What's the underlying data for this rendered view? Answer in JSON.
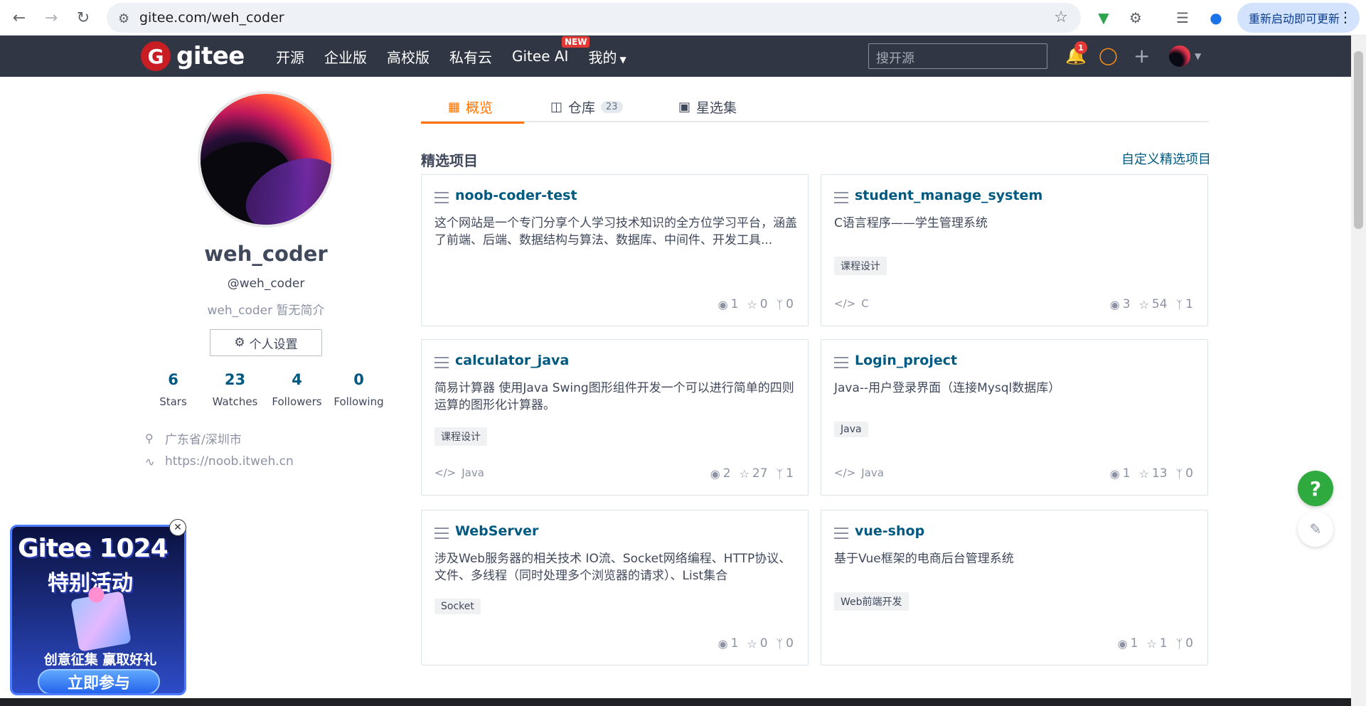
{
  "browser": {
    "url": "gitee.com/weh_coder",
    "update_label": "重新启动即可更新"
  },
  "header": {
    "logo_text": "gitee",
    "nav": [
      {
        "label": "开源"
      },
      {
        "label": "企业版"
      },
      {
        "label": "高校版"
      },
      {
        "label": "私有云"
      },
      {
        "label": "Gitee AI",
        "badge": "NEW"
      },
      {
        "label": "我的"
      }
    ],
    "search_placeholder": "搜开源",
    "notification_count": "1"
  },
  "profile": {
    "username": "weh_coder",
    "handle": "@weh_coder",
    "bio": "weh_coder 暂无简介",
    "settings_label": "个人设置",
    "stats": [
      {
        "num": "6",
        "label": "Stars"
      },
      {
        "num": "23",
        "label": "Watches"
      },
      {
        "num": "4",
        "label": "Followers"
      },
      {
        "num": "0",
        "label": "Following"
      }
    ],
    "location": "广东省/深圳市",
    "website": "https://noob.itweh.cn"
  },
  "tabs": [
    {
      "label": "概览",
      "icon": "code-icon",
      "active": true
    },
    {
      "label": "仓库",
      "icon": "repo-icon",
      "count": "23"
    },
    {
      "label": "星选集",
      "icon": "collection-icon"
    }
  ],
  "featured": {
    "title": "精选项目",
    "customize_label": "自定义精选项目",
    "projects": [
      {
        "name": "noob-coder-test",
        "desc": "这个网站是一个专门分享个人学习技术知识的全方位学习平台，涵盖了前端、后端、数据结构与算法、数据库、中间件、开发工具...",
        "tag": "",
        "lang": "",
        "watch": "1",
        "star": "0",
        "fork": "0"
      },
      {
        "name": "student_manage_system",
        "desc": "C语言程序——学生管理系统",
        "tag": "课程设计",
        "lang": "C",
        "watch": "3",
        "star": "54",
        "fork": "1"
      },
      {
        "name": "calculator_java",
        "desc": "简易计算器 使用Java Swing图形组件开发一个可以进行简单的四则运算的图形化计算器。",
        "tag": "课程设计",
        "lang": "Java",
        "watch": "2",
        "star": "27",
        "fork": "1"
      },
      {
        "name": "Login_project",
        "desc": "Java--用户登录界面（连接Mysql数据库）",
        "tag": "Java",
        "lang": "Java",
        "watch": "1",
        "star": "13",
        "fork": "0"
      },
      {
        "name": "WebServer",
        "desc": "涉及Web服务器的相关技术 IO流、Socket网络编程、HTTP协议、文件、多线程（同时处理多个浏览器的请求）、List集合",
        "tag": "Socket",
        "lang": "",
        "watch": "1",
        "star": "0",
        "fork": "0"
      },
      {
        "name": "vue-shop",
        "desc": "基于Vue框架的电商后台管理系统",
        "tag": "Web前端开发",
        "lang": "",
        "watch": "1",
        "star": "1",
        "fork": "0"
      }
    ]
  },
  "promo": {
    "title1": "Gitee 1024",
    "title2": "特别活动",
    "subtitle": "创意征集  赢取好礼",
    "cta": "立即参与"
  },
  "floating": {
    "help": "?"
  },
  "colors": {
    "accent": "#fe7300",
    "link": "#005980",
    "header_bg": "#303643",
    "help_green": "#2eaa3f"
  }
}
